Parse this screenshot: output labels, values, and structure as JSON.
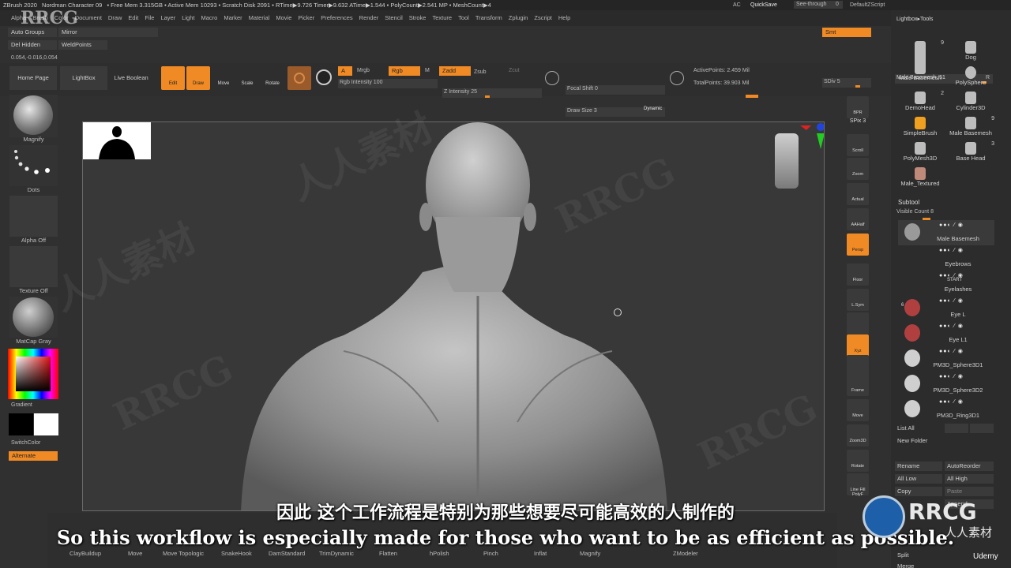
{
  "titlebar": {
    "app": "ZBrush 2020",
    "project": "Nordman Character 09",
    "stats": "• Free Mem 3.315GB • Active Mem 10293 • Scratch Disk 2091 • RTime▶9.726 Timer▶9.632 ATime▶1.544 • PolyCount▶2.541 MP • MeshCount▶4",
    "ac": "AC",
    "quicksave": "QuickSave",
    "seethrough": "See-through",
    "seethrough_value": "0",
    "script": "DefaultZScript"
  },
  "menu": [
    "Alpha",
    "Brush",
    "Color",
    "Document",
    "Draw",
    "Edit",
    "File",
    "Layer",
    "Light",
    "Macro",
    "Marker",
    "Material",
    "Movie",
    "Picker",
    "Preferences",
    "Render",
    "Stencil",
    "Stroke",
    "Texture",
    "Tool",
    "Transform",
    "Zplugin",
    "Zscript",
    "Help"
  ],
  "top_left": {
    "auto_groups": "Auto Groups",
    "mirror": "Mirror",
    "del_hidden": "Del Hidden",
    "weld_points": "WeldPoints",
    "coords": "0.054,-0.016,0.054"
  },
  "shelf": {
    "home_page": "Home Page",
    "lightbox": "LightBox",
    "live_boolean": "Live Boolean"
  },
  "tools": [
    {
      "label": "Edit",
      "on": true
    },
    {
      "label": "Draw",
      "on": true
    },
    {
      "label": "Move",
      "on": false
    },
    {
      "label": "Scale",
      "on": false
    },
    {
      "label": "Rotate",
      "on": false
    }
  ],
  "paint": {
    "a": "A",
    "mrgb": "Mrgb",
    "rgb": "Rgb",
    "m": "M",
    "zadd": "Zadd",
    "zsub": "Zsub",
    "zcut": "Zcut",
    "rgb_intensity": "Rgb Intensity 100",
    "z_intensity": "Z Intensity 25"
  },
  "focal": {
    "focal_shift": "Focal Shift 0",
    "draw_size": "Draw Size 3",
    "dynamic": "Dynamic"
  },
  "points": {
    "active": "ActivePoints: 2.459 Mil",
    "total": "TotalPoints: 39.903 Mil"
  },
  "smooth": {
    "smt": "Smt",
    "sdiv": "SDiv 5"
  },
  "left_panel": {
    "magnify": "Magnify",
    "dots": "Dots",
    "alpha_off": "Alpha Off",
    "texture_off": "Texture Off",
    "matcap": "MatCap Gray",
    "gradient": "Gradient",
    "switch_color": "SwitchColor",
    "alternate": "Alternate"
  },
  "right_icons": [
    "BPR",
    "SPix 3",
    "Scroll",
    "Zoom",
    "Actual",
    "AAHalf",
    "Persp",
    "Floor",
    "L.Sym",
    "",
    "Xyz",
    "",
    "Frame",
    "Move",
    "Zoom3D",
    "Rotate",
    "Line Fill PolyF"
  ],
  "right_icons_on": [
    false,
    false,
    false,
    false,
    false,
    false,
    true,
    false,
    false,
    false,
    true,
    false,
    false,
    false,
    false,
    false,
    false
  ],
  "lightbox": {
    "title": "Lightbox▸Tools",
    "current": "Male Basemesh. 51",
    "r": "R",
    "items": [
      {
        "name": "Male Basemesh",
        "count": "9"
      },
      {
        "name": "Dog",
        "count": ""
      },
      {
        "name": "PolySphere",
        "count": ""
      },
      {
        "name": "DemoHead",
        "count": "2"
      },
      {
        "name": "Cylinder3D",
        "count": ""
      },
      {
        "name": "SimpleBrush",
        "count": ""
      },
      {
        "name": "Male Basemesh",
        "count": "9"
      },
      {
        "name": "PolyMesh3D",
        "count": ""
      },
      {
        "name": "Base Head",
        "count": "3"
      },
      {
        "name": "Male_Textured",
        "count": ""
      }
    ]
  },
  "subtool": {
    "title": "Subtool",
    "visible": "Visible Count 8",
    "items": [
      "Male Basemesh",
      "Eyebrows",
      "Eyelashes",
      "Eye L",
      "Eye L1",
      "PM3D_Sphere3D1",
      "PM3D_Sphere3D2",
      "PM3D_Ring3D1"
    ],
    "badges": [
      "",
      "",
      "START",
      "6",
      "",
      "",
      "",
      ""
    ],
    "list_all": "List All",
    "new_folder": "New Folder",
    "rename": "Rename",
    "autoreorder": "AutoReorder",
    "all_low": "All Low",
    "all_high": "All High",
    "copy": "Copy",
    "paste": "Paste",
    "append": "Append",
    "split": "Split",
    "merge": "Merge"
  },
  "bottom_brushes": [
    "ClayBuildup",
    "Move",
    "Move Topologic",
    "SnakeHook",
    "DamStandard",
    "TrimDynamic",
    "Flatten",
    "hPolish",
    "Pinch",
    "Inflat",
    "Magnify",
    "ZModeler"
  ],
  "subtitles": {
    "zh": "因此 这个工作流程是特别为那些想要尽可能高效的人制作的",
    "en": "So this workflow is especially made for those who want to be as efficient as possible."
  },
  "watermark": {
    "brand": "RRCG",
    "cn": "人人素材",
    "udemy": "Udemy"
  },
  "colors": {
    "accent": "#f08a24",
    "bg": "#303030",
    "canvas": "#383838"
  }
}
